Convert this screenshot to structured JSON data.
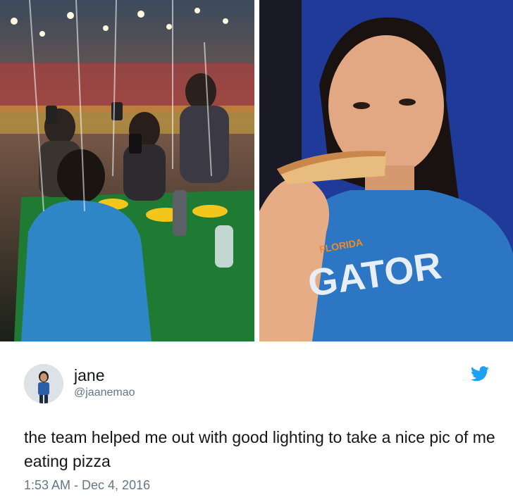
{
  "photos": {
    "left": {
      "icon": "photo-team-holding-phones"
    },
    "right": {
      "icon": "photo-woman-eating-pizza",
      "shirt_text": "GATOR",
      "shirt_small_text": "FLORIDA"
    }
  },
  "tweet": {
    "display_name": "jane",
    "handle": "@jaanemao",
    "text": "the team helped me out with good lighting to take a nice pic of me eating pizza",
    "timestamp": "1:53 AM - Dec 4, 2016",
    "brand_icon": "twitter-bird-icon",
    "brand_color": "#1da1f2"
  }
}
